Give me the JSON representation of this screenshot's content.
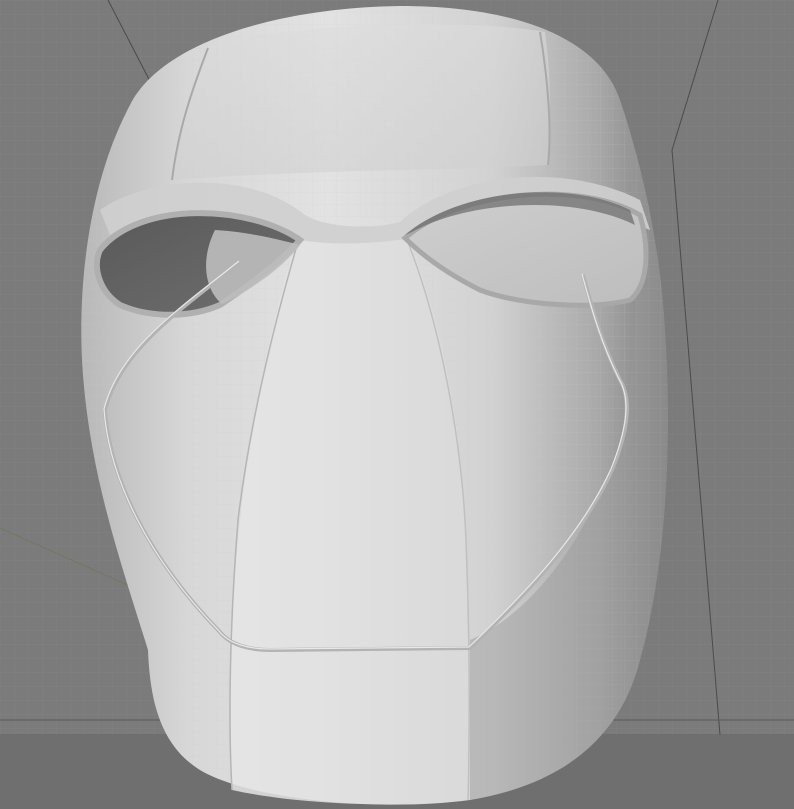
{
  "scene": {
    "object": "mask",
    "view": "3d-viewport",
    "background_color": "#7b7b7b",
    "grid_color": "#8a8a8a",
    "mesh_color": "#d9d9d9"
  }
}
